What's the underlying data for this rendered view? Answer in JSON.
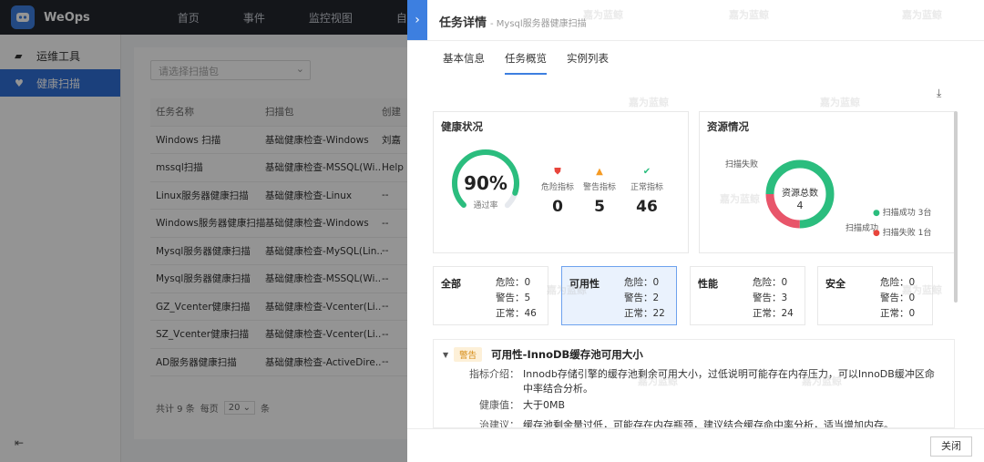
{
  "app": {
    "brand": "WeOps"
  },
  "topnav": [
    "首页",
    "事件",
    "监控视图",
    "自动化运维"
  ],
  "sidebar": {
    "items": [
      {
        "label": "运维工具",
        "icon": "toolbox-icon"
      },
      {
        "label": "健康扫描",
        "icon": "heart-icon",
        "active": true
      }
    ]
  },
  "main": {
    "filter_placeholder": "请选择扫描包",
    "columns": [
      "任务名称",
      "扫描包",
      "创建"
    ],
    "rows": [
      [
        "Windows 扫描",
        "基础健康检查-Windows",
        "刘嘉"
      ],
      [
        "mssql扫描",
        "基础健康检查-MSSQL(Wi...",
        "Help"
      ],
      [
        "Linux服务器健康扫描",
        "基础健康检查-Linux",
        "--"
      ],
      [
        "Windows服务器健康扫描",
        "基础健康检查-Windows",
        "--"
      ],
      [
        "Mysql服务器健康扫描",
        "基础健康检查-MySQL(Lin...",
        "--"
      ],
      [
        "Mysql服务器健康扫描",
        "基础健康检查-MSSQL(Wi...",
        "--"
      ],
      [
        "GZ_Vcenter健康扫描",
        "基础健康检查-Vcenter(Li...",
        "--"
      ],
      [
        "SZ_Vcenter健康扫描",
        "基础健康检查-Vcenter(Li...",
        "--"
      ],
      [
        "AD服务器健康扫描",
        "基础健康检查-ActiveDire...",
        "--"
      ]
    ],
    "pager": {
      "total": "共计 9 条",
      "per": "每页",
      "size": "20",
      "unit": "条"
    }
  },
  "drawer": {
    "title": "任务详情",
    "subtitle": "- Mysql服务器健康扫描",
    "tabs": [
      "基本信息",
      "任务概览",
      "实例列表"
    ],
    "health": {
      "title": "健康状况",
      "pass_rate": "90%",
      "pass_label": "通过率",
      "pass_fraction": 0.9,
      "metrics": [
        {
          "label": "危险指标",
          "value": "0",
          "color": "#e8453c",
          "icon": "shield-alert-icon"
        },
        {
          "label": "警告指标",
          "value": "5",
          "color": "#f59a23",
          "icon": "warning-bell-icon"
        },
        {
          "label": "正常指标",
          "value": "46",
          "color": "#2bbd7e",
          "icon": "check-circle-icon"
        }
      ]
    },
    "resource": {
      "title": "资源情况",
      "center_label": "资源总数",
      "center_value": "4",
      "label_fail": "扫描失败",
      "label_success": "扫描成功",
      "legend": [
        {
          "label": "扫描成功 3台",
          "color": "#2bbd7e"
        },
        {
          "label": "扫描失败 1台",
          "color": "#e8453c"
        }
      ],
      "slices": [
        {
          "name": "扫描成功",
          "value": 3,
          "color": "#2bbd7e"
        },
        {
          "name": "扫描失败",
          "value": 1,
          "color": "#e8556a"
        }
      ]
    },
    "categories": [
      {
        "name": "全部",
        "danger": "危险：0",
        "warn": "警告：5",
        "normal": "正常：46"
      },
      {
        "name": "可用性",
        "danger": "危险：0",
        "warn": "警告：2",
        "normal": "正常：22",
        "active": true
      },
      {
        "name": "性能",
        "danger": "危险：0",
        "warn": "警告：3",
        "normal": "正常：24"
      },
      {
        "name": "安全",
        "danger": "危险：0",
        "warn": "警告：0",
        "normal": "正常：0"
      }
    ],
    "issue": {
      "badge": "警告",
      "title": "可用性-InnoDB缓存池可用大小",
      "intro_key": "指标介绍：",
      "intro_val": "Innodb存储引擎的缓存池剩余可用大小，过低说明可能存在内存压力，可以InnoDB缓冲区命中率结合分析。",
      "health_key": "健康值：",
      "health_val": "大于0MB",
      "advice_key": "治建议：",
      "advice_val": "缓存池剩余量过低，可能存在内存瓶颈，建议结合缓存命中率分析，适当增加内存。"
    },
    "close_button": "关闭"
  },
  "watermark": "嘉为蓝鲸"
}
